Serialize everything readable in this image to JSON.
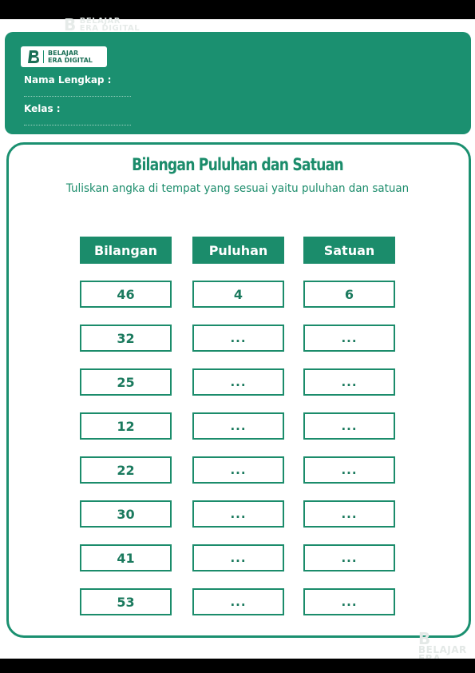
{
  "watermark": {
    "line1": "BELAJAR",
    "line2": "ERA DIGITAL"
  },
  "logo": {
    "line1": "BELAJAR",
    "line2": "ERA DIGITAL"
  },
  "fields": {
    "nama": "Nama Lengkap :",
    "kelas": "Kelas :"
  },
  "title": "Bilangan Puluhan dan Satuan",
  "subtitle": "Tuliskan angka di tempat yang sesuai yaitu puluhan dan satuan",
  "columns": [
    "Bilangan",
    "Puluhan",
    "Satuan"
  ],
  "rows": [
    {
      "bilangan": "46",
      "puluhan": "4",
      "satuan": "6"
    },
    {
      "bilangan": "32",
      "puluhan": "...",
      "satuan": "..."
    },
    {
      "bilangan": "25",
      "puluhan": "...",
      "satuan": "..."
    },
    {
      "bilangan": "12",
      "puluhan": "...",
      "satuan": "..."
    },
    {
      "bilangan": "22",
      "puluhan": "...",
      "satuan": "..."
    },
    {
      "bilangan": "30",
      "puluhan": "...",
      "satuan": "..."
    },
    {
      "bilangan": "41",
      "puluhan": "...",
      "satuan": "..."
    },
    {
      "bilangan": "53",
      "puluhan": "...",
      "satuan": "..."
    }
  ],
  "colors": {
    "primary": "#1b9070",
    "text": "#1b8c6b"
  },
  "icons": {
    "logo": "b-logo-icon"
  }
}
